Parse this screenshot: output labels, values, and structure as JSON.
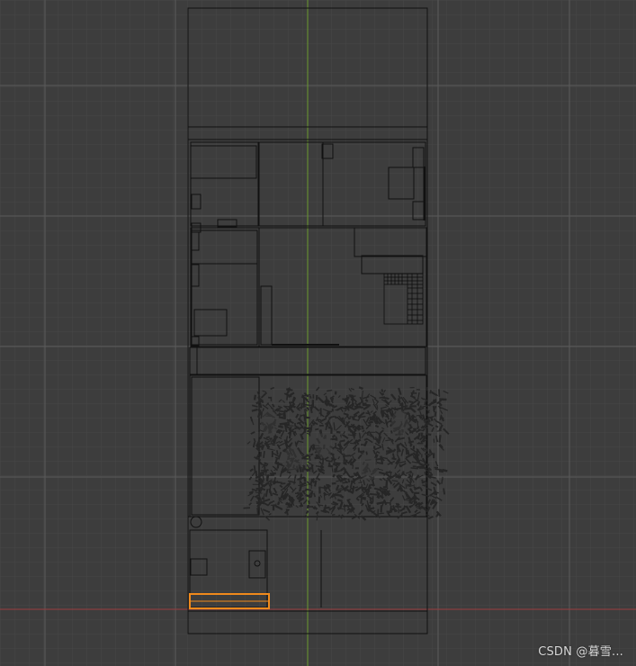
{
  "viewport": {
    "view": "top-orthographic",
    "shading": "wireframe",
    "background_color": "#3d3d3d",
    "grid_minor_color": "#474747",
    "grid_major_color": "#5a5a5a",
    "wire_color": "#101010",
    "axis_x_color": "#9b3d40",
    "axis_y_color": "#6b9a2e",
    "selected_color": "#f08a1c"
  },
  "scene": {
    "object": "house-floorplan-model",
    "selected_object": "threshold-strip",
    "foliage_color": "#262626"
  },
  "watermark": {
    "text": "CSDN @暮雪..."
  }
}
